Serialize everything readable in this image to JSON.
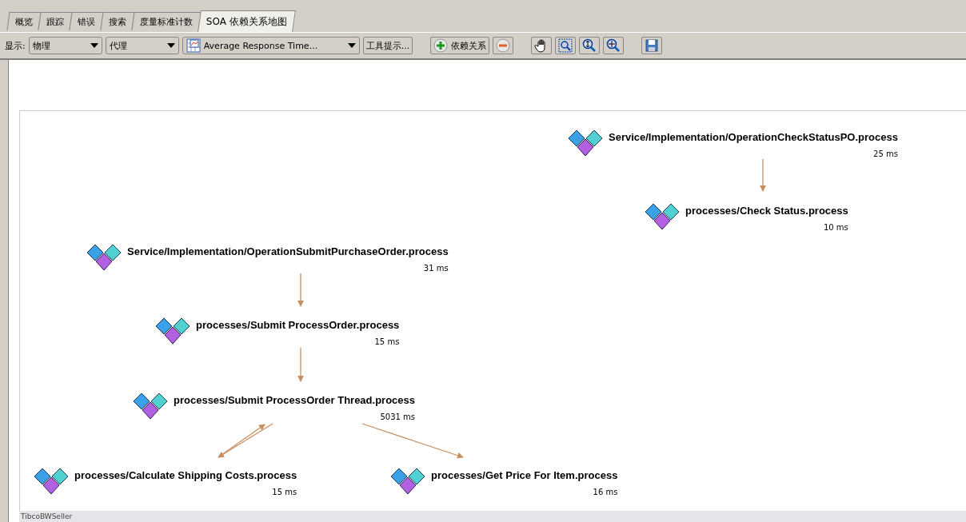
{
  "tabs": [
    {
      "label": "概览",
      "selected": false
    },
    {
      "label": "跟踪",
      "selected": false
    },
    {
      "label": "错误",
      "selected": false
    },
    {
      "label": "搜索",
      "selected": false
    },
    {
      "label": "度量标准计数",
      "selected": false
    },
    {
      "label": "SOA 依赖关系地图",
      "selected": true
    }
  ],
  "toolbar": {
    "display_label": "显示:",
    "dropdowns": [
      {
        "kind": "plain",
        "value": "物理"
      },
      {
        "kind": "plain",
        "value": "代理"
      },
      {
        "kind": "metric",
        "value": "Average Response Time..."
      }
    ],
    "tooltip_button": "工具提示...",
    "add_dependency_button": "依赖关系"
  },
  "map": {
    "nodes": [
      {
        "name": "Service/Implementation/OperationCheckStatusPO.process",
        "time": "25 ms"
      },
      {
        "name": "processes/Check Status.process",
        "time": "10 ms"
      },
      {
        "name": "Service/Implementation/OperationSubmitPurchaseOrder.process",
        "time": "31 ms"
      },
      {
        "name": "processes/Submit ProcessOrder.process",
        "time": "15 ms"
      },
      {
        "name": "processes/Submit ProcessOrder Thread.process",
        "time": "5031 ms"
      },
      {
        "name": "processes/Calculate Shipping Costs.process",
        "time": "15 ms"
      },
      {
        "name": "processes/Get Price For Item.process",
        "time": "16 ms"
      }
    ],
    "footer": "TibcoBWSeller"
  }
}
